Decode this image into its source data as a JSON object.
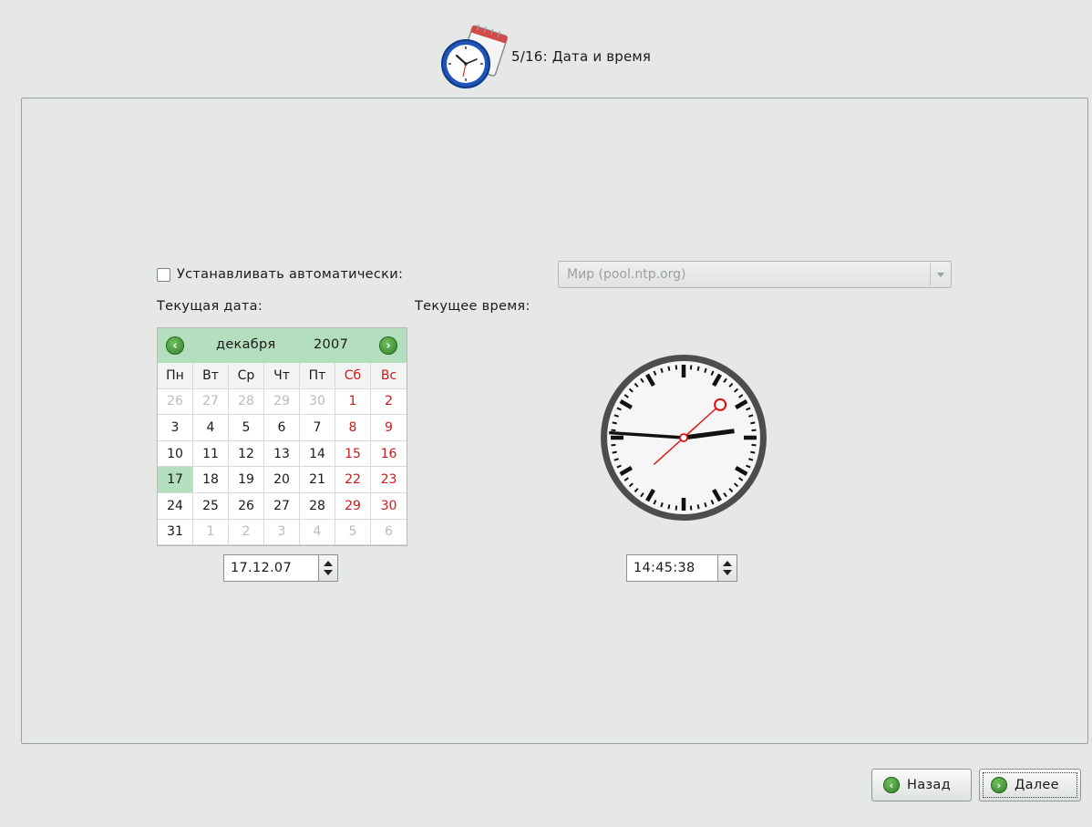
{
  "header": {
    "title": "5/16: Дата и время",
    "icon": "clock-calendar-icon"
  },
  "auto_sync": {
    "checked": false,
    "label": "Устанавливать автоматически:",
    "ntp_server": "Мир (pool.ntp.org)"
  },
  "date_section": {
    "label": "Текущая дата:",
    "calendar": {
      "month": "декабря",
      "year": "2007",
      "weekdays": [
        "Пн",
        "Вт",
        "Ср",
        "Чт",
        "Пт",
        "Сб",
        "Вс"
      ],
      "weeks": [
        [
          "26",
          "27",
          "28",
          "29",
          "30",
          "1",
          "2"
        ],
        [
          "3",
          "4",
          "5",
          "6",
          "7",
          "8",
          "9"
        ],
        [
          "10",
          "11",
          "12",
          "13",
          "14",
          "15",
          "16"
        ],
        [
          "17",
          "18",
          "19",
          "20",
          "21",
          "22",
          "23"
        ],
        [
          "24",
          "25",
          "26",
          "27",
          "28",
          "29",
          "30"
        ],
        [
          "31",
          "1",
          "2",
          "3",
          "4",
          "5",
          "6"
        ]
      ],
      "selected_day": "17"
    },
    "value": "17.12.07"
  },
  "time_section": {
    "label": "Текущее время:",
    "value": "14:45:38"
  },
  "buttons": {
    "back": "Назад",
    "next": "Далее"
  },
  "colors": {
    "accent_green": "#b4dfbe",
    "weekend_red": "#d01818",
    "second_hand": "#e01010"
  }
}
